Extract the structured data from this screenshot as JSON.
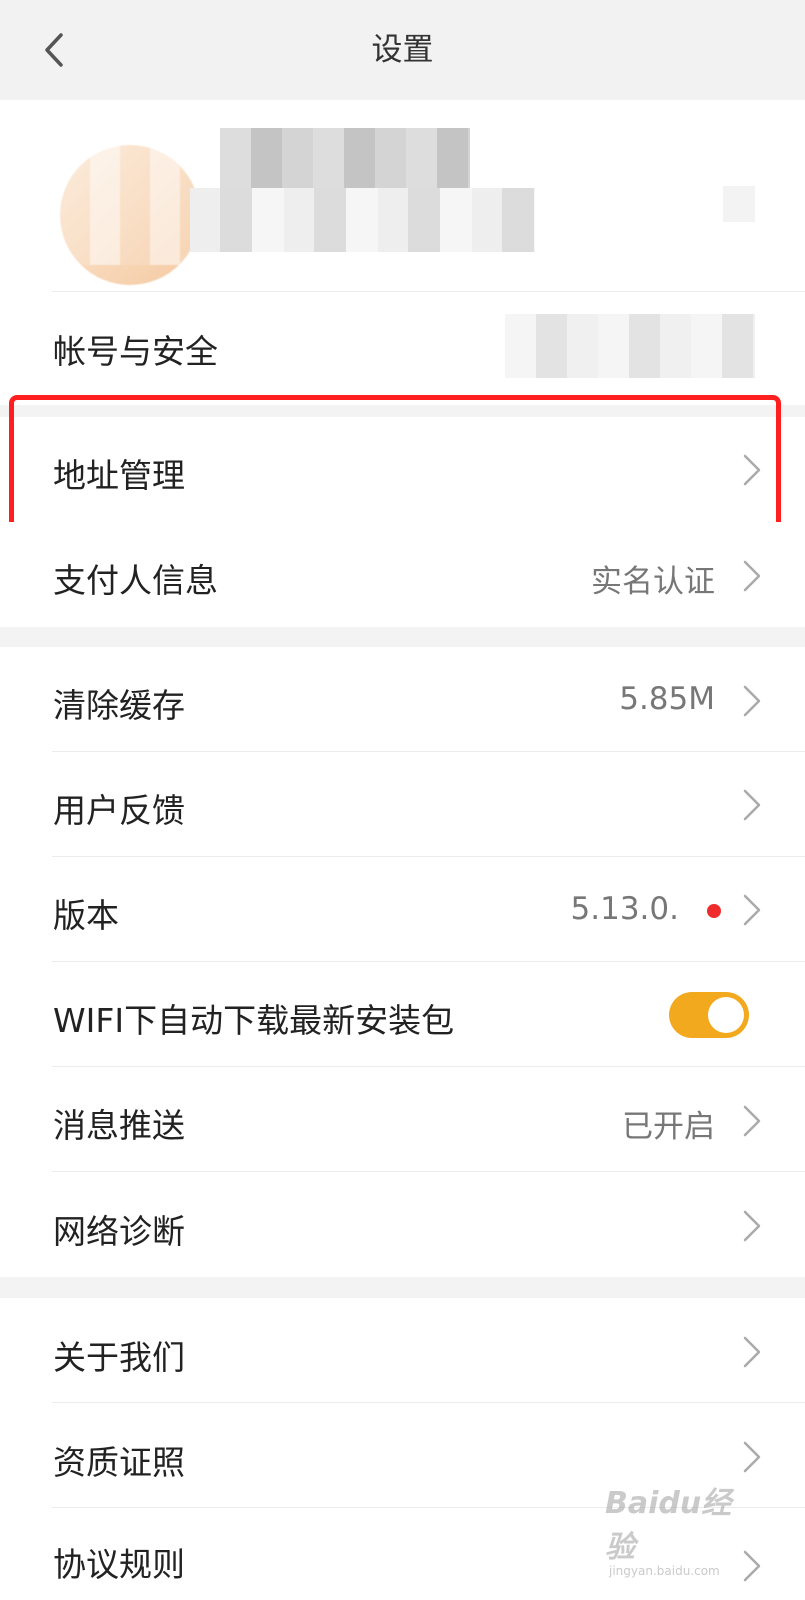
{
  "header": {
    "title": "设置"
  },
  "rows": {
    "account": {
      "label": "帐号与安全"
    },
    "address": {
      "label": "地址管理"
    },
    "payer": {
      "label": "支付人信息",
      "value": "实名认证"
    },
    "cache": {
      "label": "清除缓存",
      "value": "5.85M"
    },
    "feedback": {
      "label": "用户反馈"
    },
    "version": {
      "label": "版本",
      "value": "5.13.0."
    },
    "wifi": {
      "label": "WIFI下自动下载最新安装包",
      "toggle_on": true
    },
    "push": {
      "label": "消息推送",
      "value": "已开启"
    },
    "network": {
      "label": "网络诊断"
    },
    "about": {
      "label": "关于我们"
    },
    "license": {
      "label": "资质证照"
    },
    "rules": {
      "label": "协议规则"
    }
  },
  "watermark": {
    "brand": "Baidu经验",
    "url": "jingyan.baidu.com"
  },
  "colors": {
    "accent": "#f2a91d",
    "highlight": "#ff1f1f",
    "dot": "#ef2b2b",
    "section_gap": "#f3f3f3"
  },
  "icons": {
    "back": "chevron-left-icon",
    "row_arrow": "chevron-right-icon"
  }
}
